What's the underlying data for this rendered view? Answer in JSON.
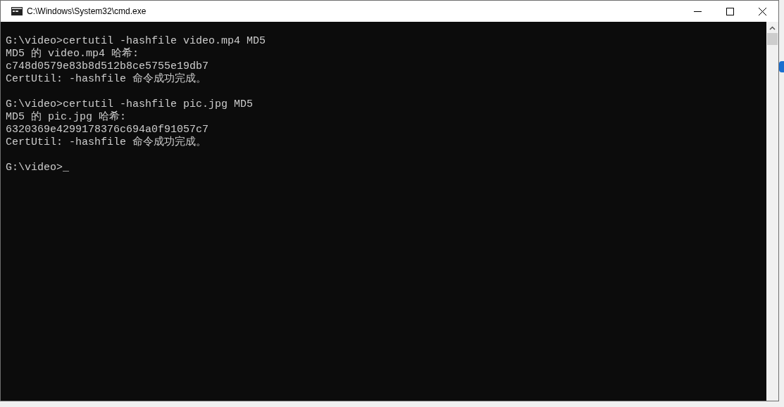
{
  "window": {
    "title": "C:\\Windows\\System32\\cmd.exe"
  },
  "console": {
    "blocks": [
      {
        "lines": [
          "G:\\video>certutil -hashfile video.mp4 MD5",
          "MD5 的 video.mp4 哈希:",
          "c748d0579e83b8d512b8ce5755e19db7",
          "CertUtil: -hashfile 命令成功完成。"
        ]
      },
      {
        "lines": [
          "G:\\video>certutil -hashfile pic.jpg MD5",
          "MD5 的 pic.jpg 哈希:",
          "6320369e4299178376c694a0f91057c7",
          "CertUtil: -hashfile 命令成功完成。"
        ]
      }
    ],
    "prompt": "G:\\video>",
    "cursor": "_"
  }
}
